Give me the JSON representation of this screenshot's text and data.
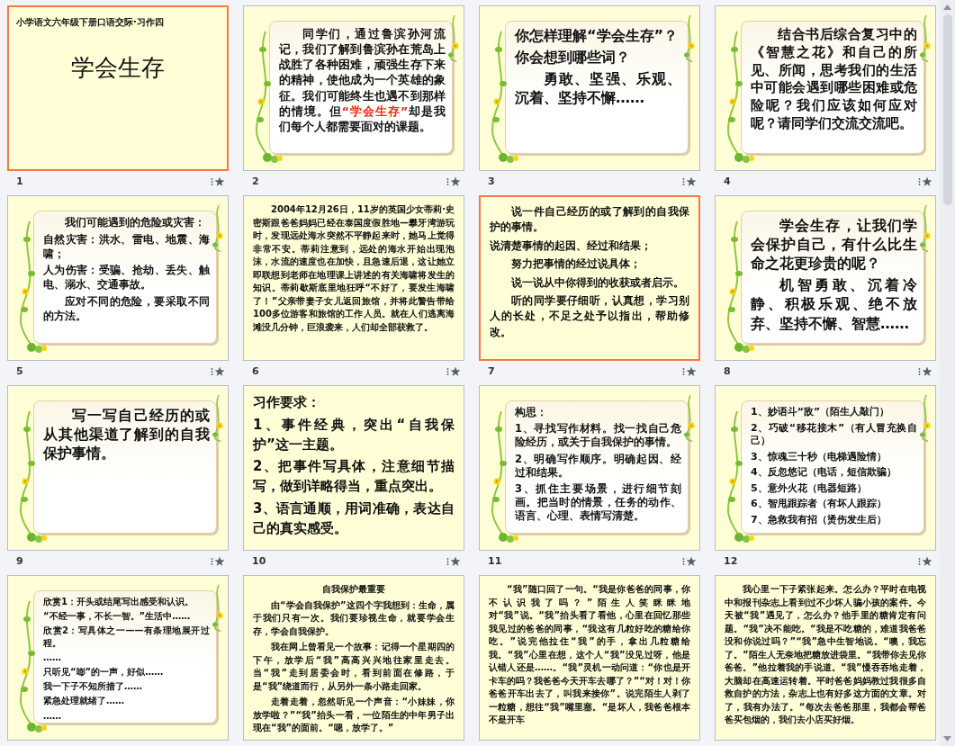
{
  "slides": [
    {
      "number": "1",
      "selected": true,
      "kind": "title",
      "subtitle": "小学语文六年级下册口语交际·习作四",
      "title": "学会生存"
    },
    {
      "number": "2",
      "selected": false,
      "kind": "framed",
      "paragraphs": [
        {
          "kind": "indented",
          "runs": [
            {
              "text": "同学们，通过鲁滨孙河流记，我们了解到鲁滨孙在荒岛上战胜了各种困难，顽强生存下来的精神，使他成为一个英雄的象征。我们可能终生也遇不到那样的情境。但",
              "highlight": false
            },
            {
              "text": "“学会生存”",
              "highlight": true
            },
            {
              "text": "却是我们每个人都需要面对的课题。",
              "highlight": false
            }
          ]
        }
      ]
    },
    {
      "number": "3",
      "selected": false,
      "kind": "framed",
      "paragraphs": [
        {
          "kind": "flush",
          "text": "你怎样理解“学会生存”？"
        },
        {
          "kind": "flush",
          "text": "你会想到哪些词？"
        },
        {
          "kind": "indented",
          "text": "勇敢、坚强、乐观、沉着、坚持不懈……"
        }
      ]
    },
    {
      "number": "4",
      "selected": false,
      "kind": "framed",
      "paragraphs": [
        {
          "kind": "indented",
          "text": "结合书后综合复习中的《智慧之花》和自己的所见、所闻，思考我们的生活中可能会遇到哪些困难或危险呢？我们应该如何应对呢？请同学们交流交流吧。"
        }
      ]
    },
    {
      "number": "5",
      "selected": false,
      "kind": "framed",
      "paragraphs": [
        {
          "kind": "indented",
          "text": "我们可能遇到的危险或灾害："
        },
        {
          "kind": "flush",
          "text": "自然灾害：洪水、雷电、地震、海啸；"
        },
        {
          "kind": "flush",
          "text": "人为伤害：受骗、抢劫、丢失、触电、溺水、交通事故。"
        },
        {
          "kind": "indented",
          "text": "应对不同的危险，要采取不同的方法。"
        }
      ]
    },
    {
      "number": "6",
      "selected": false,
      "kind": "plain",
      "paragraphs": [
        {
          "kind": "indented",
          "text": "2004年12月26日，11岁的英国少女蒂莉·史密斯跟爸爸妈妈已经在泰国度假胜地—攀牙湾游玩时，发现远处海水突然不平静起来时，她马上觉得非常不安。蒂莉注意到，远处的海水开始出现泡沫，水流的速度也在加快，且急速后退，这让她立即联想到老师在地理课上讲述的有关海啸将发生的知识。蒂莉歇斯底里地狂呼“不好了，要发生海啸了！”父亲带妻子女儿返回旅馆，并将此警告带给100多位游客和旅馆的工作人员。就在人们逃离海滩没几分钟，巨浪袭来，人们却全部获救了。"
        }
      ]
    },
    {
      "number": "7",
      "selected": true,
      "kind": "plain",
      "paragraphs": [
        {
          "kind": "indented",
          "text": "说一件自己经历的或了解到的自我保护的事情。"
        },
        {
          "kind": "flush",
          "text": "说清楚事情的起因、经过和结果；"
        },
        {
          "kind": "indented",
          "text": "努力把事情的经过说具体；"
        },
        {
          "kind": "indented",
          "text": "说一说从中你得到的收获或者启示。"
        },
        {
          "kind": "indented",
          "text": "听的同学要仔细听，认真想，学习别人的长处，不足之处予以指出，帮助修改。"
        }
      ]
    },
    {
      "number": "8",
      "selected": false,
      "kind": "framed",
      "paragraphs": [
        {
          "kind": "indented",
          "text": "学会生存，让我们学会保护自己，有什么比生命之花更珍贵的呢？"
        },
        {
          "kind": "indented",
          "text": "机智勇敢、沉着冷静、积极乐观、绝不放弃、坚持不懈、智慧……"
        }
      ]
    },
    {
      "number": "9",
      "selected": false,
      "kind": "framed",
      "paragraphs": [
        {
          "kind": "indented",
          "text": "写一写自己经历的或从其他渠道了解到的自我保护事情。"
        }
      ]
    },
    {
      "number": "10",
      "selected": false,
      "kind": "plain",
      "paragraphs": [
        {
          "kind": "flush",
          "text": "习作要求："
        },
        {
          "kind": "flush",
          "text": "1、事件经典，突出“自我保护”这一主题。"
        },
        {
          "kind": "flush",
          "text": "2、把事件写具体，注意细节描写，做到详略得当，重点突出。"
        },
        {
          "kind": "flush",
          "text": "3、语言通顺，用词准确，表达自己的真实感受。"
        }
      ]
    },
    {
      "number": "11",
      "selected": false,
      "kind": "framed",
      "paragraphs": [
        {
          "kind": "flush",
          "text": "构思："
        },
        {
          "kind": "flush",
          "text": "1、寻找写作材料。找一找自己危险经历，或关于自我保护的事情。"
        },
        {
          "kind": "flush",
          "text": "2、明确写作顺序。明确起因、经过和结果。"
        },
        {
          "kind": "flush",
          "text": "3、抓住主要场景，进行细节刻画。把当时的情景，任务的动作、语言、心理、表情写清楚。"
        }
      ]
    },
    {
      "number": "12",
      "selected": false,
      "kind": "framed",
      "paragraphs": [
        {
          "kind": "flush",
          "text": "1、妙语斗“敌”（陌生人敲门）"
        },
        {
          "kind": "flush",
          "text": "2、巧破“移花接木”（有人冒充换自己）"
        },
        {
          "kind": "flush",
          "text": "3、惊魂三十秒（电梯遇险情）"
        },
        {
          "kind": "flush",
          "text": "4、反忽悠记（电话，短信欺骗）"
        },
        {
          "kind": "flush",
          "text": "5、意外火花（电器短路）"
        },
        {
          "kind": "flush",
          "text": "6、智甩跟踪者（有坏人跟踪）"
        },
        {
          "kind": "flush",
          "text": "7、急救我有招（烫伤发生后）"
        }
      ]
    },
    {
      "selected": false,
      "kind": "framed",
      "paragraphs": [
        {
          "kind": "flush",
          "text": "欣赏1：开头或结尾写出感受和认识。"
        },
        {
          "kind": "flush",
          "text": "“不经一事，不长一智。”生活中……"
        },
        {
          "kind": "flush",
          "text": "欣赏2：写具体之一——有条理地展开过程。"
        },
        {
          "kind": "flush",
          "text": "……"
        },
        {
          "kind": "flush",
          "text": "只听见“嘭”的一声，好似……"
        },
        {
          "kind": "flush",
          "text": "我一下子不知所措了……"
        },
        {
          "kind": "flush",
          "text": "紧急处理就绪了……"
        },
        {
          "kind": "flush",
          "text": "……"
        }
      ]
    },
    {
      "selected": false,
      "kind": "plain",
      "paragraphs": [
        {
          "kind": "heading",
          "text": "自我保护最重要"
        },
        {
          "kind": "indented",
          "text": "由“学会自我保护”这四个字我想到：生命，属于我们只有一次。我们要珍视生命，就要学会生存，学会自我保护。"
        },
        {
          "kind": "indented",
          "text": "我在网上曾看见一个故事：记得一个星期四的下午，放学后“我”高高兴兴地往家里走去。当“我”走到居委会时，看到前面在修路，于是“我”绕道而行，从另外一条小路走回家。"
        },
        {
          "kind": "indented",
          "text": "走着走着，忽然听见一个声音：“小妹妹，你放学啦？”“我”抬头一看，一位陌生的中年男子出现在“我”的面前。“嗯，放学了。”"
        }
      ]
    },
    {
      "selected": false,
      "kind": "plain",
      "paragraphs": [
        {
          "kind": "indented",
          "text": "“我”随口回了一句。“我是你爸爸的同事，你不认识我了吗？”陌生人笑眯眯地对“我”说。“我”抬头看了看他，心里在回忆那些我见过的爸爸的同事，“我这有几粒好吃的糖给你吃。”说完他拉住“我”的手，拿出几粒糖给我。“我”心里在想，这个人“我”没见过呀，他是认错人还是……。“我”灵机一动问道：“你也是开卡车的吗？我爸爸今天开车去哪了？”“对！对！你爸爸开车出去了，叫我来接你”。说完陌生人剥了一粒糖，想往“我”嘴里塞。“是坏人，我爸爸根本不是开车"
        }
      ]
    },
    {
      "selected": false,
      "kind": "plain",
      "paragraphs": [
        {
          "kind": "indented",
          "text": "我心里一下子紧张起来。怎么办？平时在电视中和报刊杂志上看到过不少坏人骗小孩的案件。今天被“我”遇见了，怎么办？他手里的糖肯定有问题。“我”决不能吃。“我是不吃糖的，难道我爸爸没和你说过吗？”“我”急中生智地说。“噢，我忘了。”陌生人无奈地把糖放进袋里。“我带你去见你爸爸。”他拉着我的手说道。“我”慢吞吞地走着，大脑却在高速运转着。平时爸爸妈妈教过我很多自救自护的方法，杂志上也有好多这方面的文章。对了，我有办法了。“每次去爸爸那里，我都会帮爸爸买包烟的，我们去小店买好烟。"
        }
      ]
    }
  ]
}
